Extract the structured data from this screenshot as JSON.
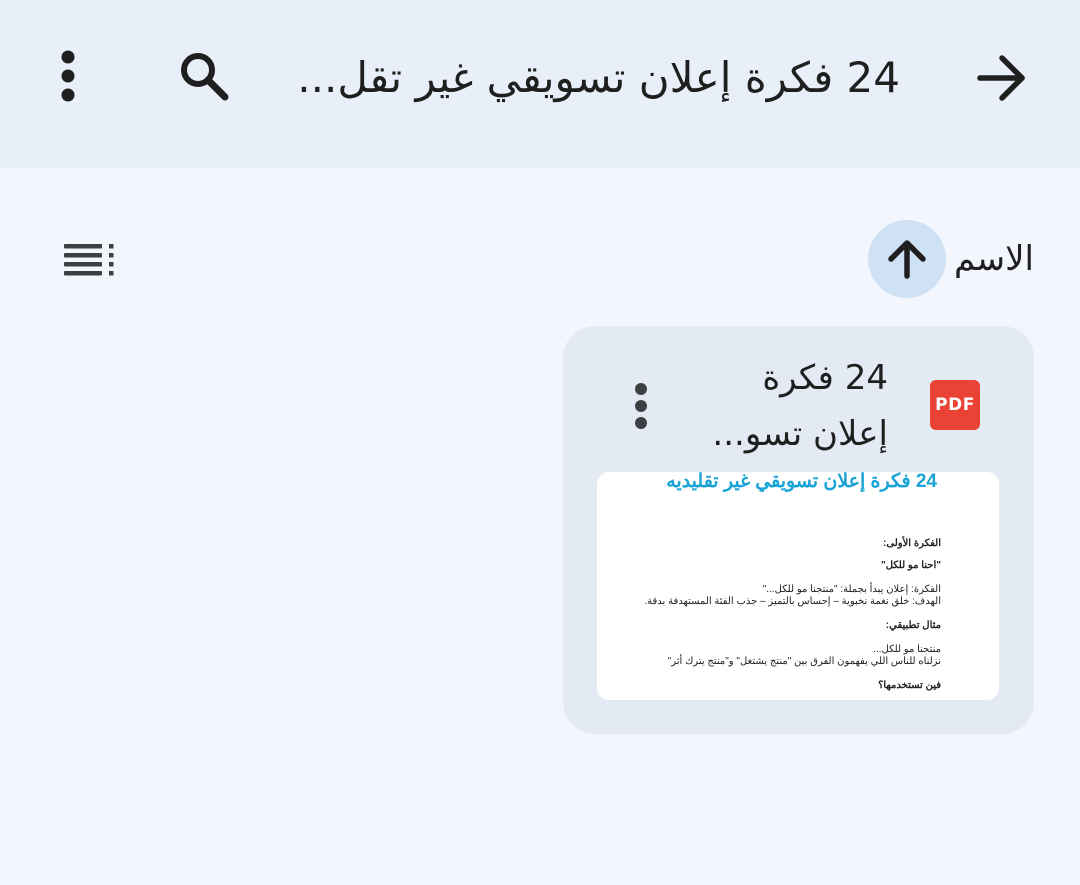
{
  "header": {
    "title": "24 فكرة إعلان تسويقي غير تقل...",
    "back_icon": "arrow-forward-icon",
    "search_icon": "search-icon",
    "more_icon": "more-vert-icon"
  },
  "sort": {
    "label": "الاسم",
    "direction_icon": "arrow-up-icon",
    "view_icon": "list-view-icon"
  },
  "file": {
    "badge": "PDF",
    "title_line1": "24 فكرة",
    "title_line2": "إعلان تسو...",
    "preview": {
      "heading": "24 فكرة إعلان تسويقي غير تقليديه",
      "lines": [
        "الفكرة الأولى:",
        "\"احنا مو للكل\"",
        "الفكرة: إعلان يبدأ بجملة: \"منتجنا مو للكل...\"",
        "الهدف: خلق نغمة نخبوية – إحساس بالتميز – جذب الفئة المستهدفة بدقة.",
        "مثال تطبيقي:",
        "منتجنا مو للكل...",
        "نزلناه للناس اللي يفهمون الفرق بين \"منتج يشتغل\" و\"منتج يترك أثر\"",
        "فين تستخدمها؟"
      ]
    }
  },
  "colors": {
    "topbar": "#e9eff8",
    "background": "#f3f6fc",
    "card": "#e3eaf4",
    "sort_button": "#cfe2f5",
    "pdf_badge": "#ea4335",
    "preview_heading": "#19a3d6"
  }
}
